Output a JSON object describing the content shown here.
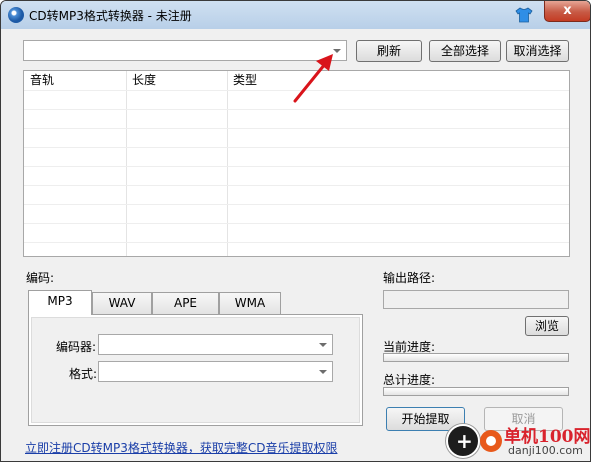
{
  "window": {
    "title": "CD转MP3格式转换器 - 未注册",
    "close_label": "x"
  },
  "source": {
    "selected": ""
  },
  "toolbar": {
    "refresh": "刷新",
    "select_all": "全部选择",
    "deselect": "取消选择"
  },
  "track_list": {
    "columns": [
      "音轨",
      "长度",
      "类型"
    ],
    "rows": []
  },
  "encode": {
    "label": "编码:",
    "tabs": [
      "MP3",
      "WAV",
      "APE",
      "WMA"
    ],
    "active_tab": "MP3",
    "encoder_label": "编码器:",
    "encoder_value": "",
    "format_label": "格式:",
    "format_value": ""
  },
  "output": {
    "label": "输出路径:",
    "path": "",
    "browse": "浏览"
  },
  "progress": {
    "current_label": "当前进度:",
    "current_value": 0,
    "total_label": "总计进度:",
    "total_value": 0
  },
  "actions": {
    "start": "开始提取",
    "cancel": "取消"
  },
  "register_link": "立即注册CD转MP3格式转换器，获取完整CD音乐提取权限",
  "watermark": {
    "brand": "单机100网",
    "url": "danji100.com"
  },
  "colors": {
    "titlebar": "#b8cfe8",
    "close": "#c75a45",
    "link": "#1a3ea8",
    "arrow": "#d9141b"
  }
}
